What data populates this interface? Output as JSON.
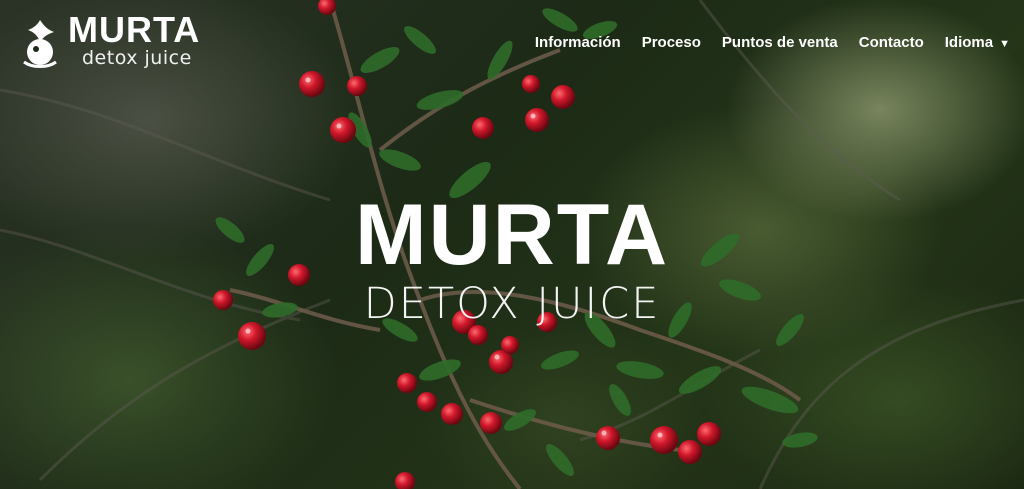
{
  "brand": {
    "title": "MURTA",
    "subtitle": "detox juice"
  },
  "nav": {
    "items": [
      {
        "label": "Información"
      },
      {
        "label": "Proceso"
      },
      {
        "label": "Puntos de venta"
      },
      {
        "label": "Contacto"
      },
      {
        "label": "Idioma"
      }
    ]
  },
  "hero": {
    "title": "MURTA",
    "subtitle": "DETOX JUICE"
  },
  "colors": {
    "berry": "#c8182a",
    "leaf": "#2f6b2a",
    "text": "#ffffff"
  },
  "icons": {
    "logo": "murta-berry-logo-icon",
    "dropdown": "caret-down-icon"
  }
}
